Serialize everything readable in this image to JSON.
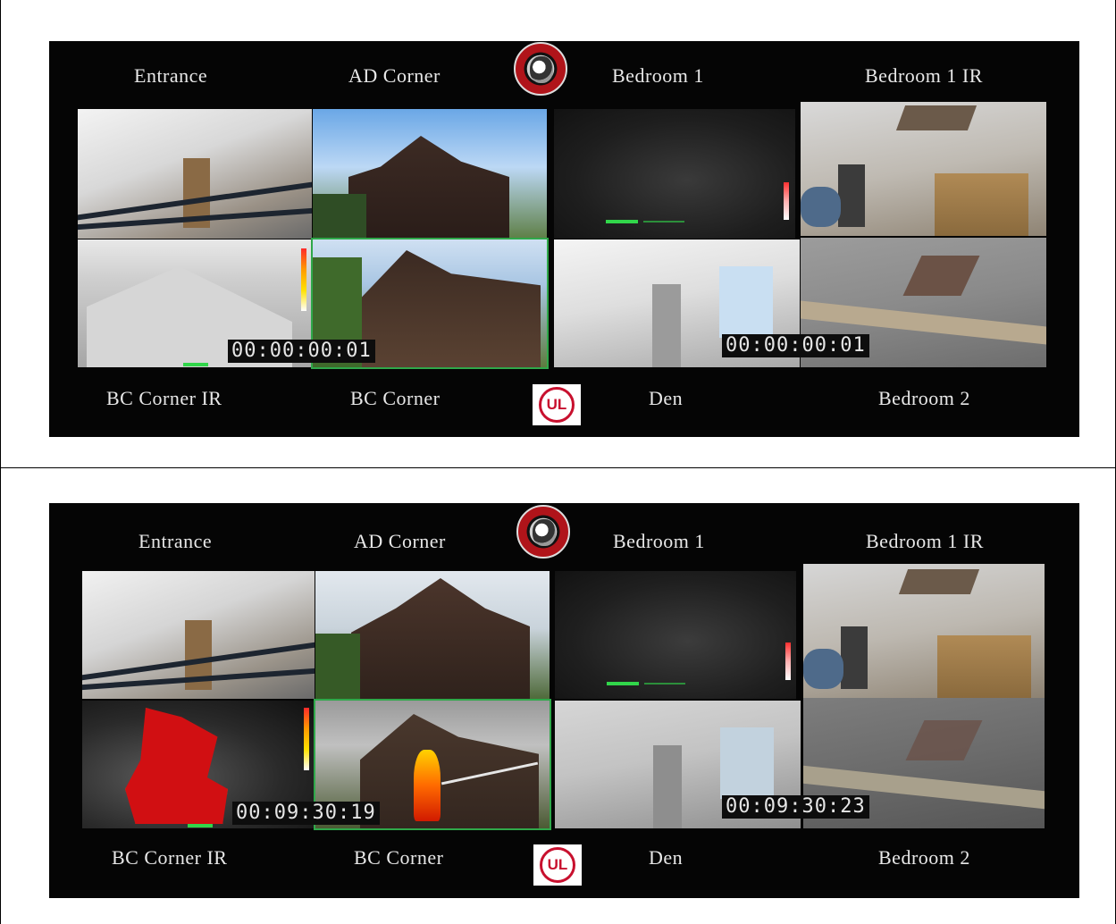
{
  "figure": {
    "panels": [
      {
        "id": "top",
        "top_labels": [
          "Entrance",
          "AD Corner",
          "Bedroom 1",
          "Bedroom 1 IR"
        ],
        "bottom_labels": [
          "BC Corner IR",
          "BC Corner",
          "Den",
          "Bedroom 2"
        ],
        "timecode_left": "00:00:00:01",
        "timecode_right": "00:00:00:01"
      },
      {
        "id": "bottom",
        "top_labels": [
          "Entrance",
          "AD Corner",
          "Bedroom 1",
          "Bedroom 1 IR"
        ],
        "bottom_labels": [
          "BC Corner IR",
          "BC Corner",
          "Den",
          "Bedroom 2"
        ],
        "timecode_left": "00:09:30:19",
        "timecode_right": "00:09:30:23"
      }
    ],
    "logos": {
      "ul": "UL"
    },
    "colors": {
      "fire_red": "#c8102e",
      "thermal_red": "#d10f12",
      "ir_green": "#31d64a"
    }
  }
}
